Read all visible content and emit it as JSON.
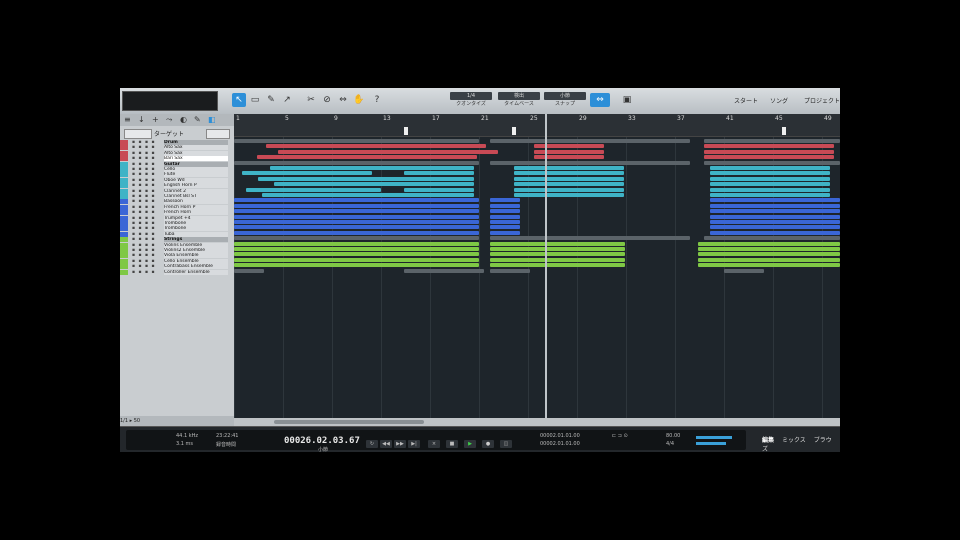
{
  "toolbar": {
    "tools": [
      "↖",
      "▭",
      "✎",
      "↗",
      "✂",
      "⊘",
      "⇔",
      "✋",
      "?"
    ],
    "btn1_cap": "1/4",
    "btn1_sub": "クオンタイズ",
    "btn2_cap": "検出",
    "btn2_sub": "タイムベース",
    "btn3_cap": "小節",
    "btn3_sub": "スナップ",
    "right_tabs": [
      "スタート",
      "ソング",
      "プロジェクト"
    ]
  },
  "leftpanel": {
    "folder_label": "ターゲット",
    "tracks": [
      {
        "name": "Drum",
        "color": "#c84a55",
        "type": "folder"
      },
      {
        "name": "Alto Sax",
        "color": "#c84a55",
        "type": "track"
      },
      {
        "name": "Alto Sax",
        "color": "#c84a55",
        "type": "track"
      },
      {
        "name": "Bari Sax",
        "color": "#c84a55",
        "type": "selected"
      },
      {
        "name": "Guitar",
        "color": "#3fb3c6",
        "type": "folder"
      },
      {
        "name": "Cello",
        "color": "#3fb3c6",
        "type": "track"
      },
      {
        "name": "Flute",
        "color": "#3fb3c6",
        "type": "track"
      },
      {
        "name": "Oboe Wd",
        "color": "#3fb3c6",
        "type": "track"
      },
      {
        "name": "English Horn P",
        "color": "#3fb3c6",
        "type": "track"
      },
      {
        "name": "Clarinet 2",
        "color": "#3fb3c6",
        "type": "track"
      },
      {
        "name": "Clarinet Bsl ST",
        "color": "#3fb3c6",
        "type": "track"
      },
      {
        "name": "Bassoon",
        "color": "#3a66d6",
        "type": "track"
      },
      {
        "name": "French Horn P",
        "color": "#3a66d6",
        "type": "track"
      },
      {
        "name": "French Horn",
        "color": "#3a66d6",
        "type": "track"
      },
      {
        "name": "Trumpet +4",
        "color": "#3a66d6",
        "type": "track"
      },
      {
        "name": "Trombone",
        "color": "#3a66d6",
        "type": "track"
      },
      {
        "name": "Trombone",
        "color": "#3a66d6",
        "type": "track"
      },
      {
        "name": "Tuba",
        "color": "#3a66d6",
        "type": "track"
      },
      {
        "name": "Strings",
        "color": "#7fc845",
        "type": "folder"
      },
      {
        "name": "Violins Ensemble",
        "color": "#7fc845",
        "type": "track"
      },
      {
        "name": "Violins2 Ensemble",
        "color": "#7fc845",
        "type": "track"
      },
      {
        "name": "Viola Ensemble",
        "color": "#7fc845",
        "type": "track"
      },
      {
        "name": "Cello Ensemble",
        "color": "#7fc845",
        "type": "track"
      },
      {
        "name": "Contrabass Ensemble",
        "color": "#7fc845",
        "type": "track"
      },
      {
        "name": "Controller Ensemble",
        "color": "#7fc845",
        "type": "track"
      }
    ],
    "bottom": "1/1 ▸ 50"
  },
  "ruler": {
    "bars": [
      "1",
      "5",
      "9",
      "13",
      "17",
      "21",
      "25",
      "29",
      "33",
      "37",
      "41",
      "45",
      "49"
    ]
  },
  "transport": {
    "sample_rate": "44.1 kHz",
    "latency": "3.1 ms",
    "record_time": "23:22:41",
    "record_label": "録音時間",
    "time": "00026.02.03.67",
    "time_label": "小節",
    "loop_start": "00002.01.01.00",
    "loop_end": "00002.01.01.00",
    "tempo": "80.00",
    "signature": "4/4",
    "right_tabs": [
      "編集",
      "ミックス",
      "ブラウズ"
    ]
  }
}
